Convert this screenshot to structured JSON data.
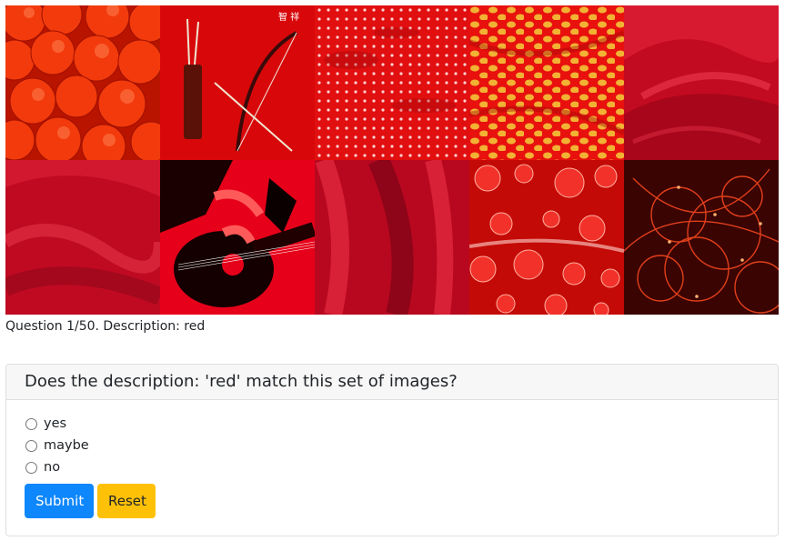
{
  "caption": "Question 1/50. Description: red",
  "question": {
    "title": "Does the description: 'red' match this set of images?",
    "options": [
      "yes",
      "maybe",
      "no"
    ]
  },
  "buttons": {
    "submit": "Submit",
    "reset": "Reset"
  },
  "colors": {
    "primary": "#0d87fb",
    "warning": "#ffc107",
    "accent_red": "#e00000"
  },
  "images": [
    {
      "name": "tangerines-image"
    },
    {
      "name": "bow-and-arrows-image",
      "text": "智 祥"
    },
    {
      "name": "white-dot-pattern-image"
    },
    {
      "name": "yellow-polka-dot-fabric-image"
    },
    {
      "name": "red-silk-image"
    },
    {
      "name": "red-satin-image"
    },
    {
      "name": "guitar-player-image"
    },
    {
      "name": "red-drape-image"
    },
    {
      "name": "red-bubbles-image"
    },
    {
      "name": "red-light-trails-image"
    }
  ]
}
